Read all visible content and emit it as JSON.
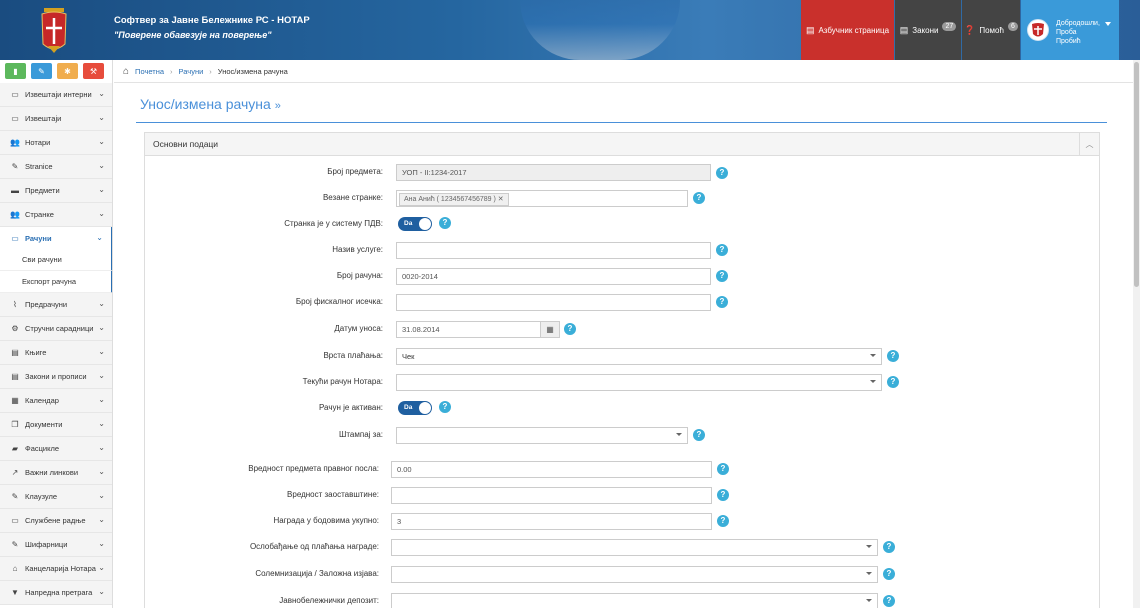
{
  "header": {
    "title": "Софтвер за Јавне Бележнике РС - НОТАР",
    "subtitle": "\"Поверене обавезује на поверење\"",
    "alphabet_label": "Азбучник страница",
    "laws_label": "Закони",
    "laws_count": "27",
    "help_label": "Помоћ",
    "help_count": "6",
    "user_greeting": "Добродошли,",
    "user_first": "Проба",
    "user_last": "Пробић"
  },
  "quick_buttons": [
    {
      "icon": "bar-chart-icon",
      "color": "#5cb85c"
    },
    {
      "icon": "pencil-icon",
      "color": "#3a9ad9"
    },
    {
      "icon": "gear-icon",
      "color": "#f0ad4e"
    },
    {
      "icon": "tools-icon",
      "color": "#e74c3c"
    }
  ],
  "sidebar": {
    "items": [
      {
        "label": "Извештаји интерни",
        "icon": "hdd-icon"
      },
      {
        "label": "Извештаји",
        "icon": "hdd-icon"
      },
      {
        "label": "Нотари",
        "icon": "users-icon"
      },
      {
        "label": "Stranice",
        "icon": "edit-icon"
      },
      {
        "label": "Предмети",
        "icon": "briefcase-icon"
      },
      {
        "label": "Странке",
        "icon": "users-icon"
      },
      {
        "label": "Рачуни",
        "icon": "credit-card-icon",
        "active": true
      },
      {
        "label": "Предрачуни",
        "icon": "paperclip-icon"
      },
      {
        "label": "Стручни сарадници",
        "icon": "wrench-icon"
      },
      {
        "label": "Књиге",
        "icon": "book-icon"
      },
      {
        "label": "Закони и прописи",
        "icon": "book-icon"
      },
      {
        "label": "Календар",
        "icon": "calendar-icon"
      },
      {
        "label": "Документи",
        "icon": "copy-icon"
      },
      {
        "label": "Фасцикле",
        "icon": "folder-icon"
      },
      {
        "label": "Важни линкови",
        "icon": "external-link-icon"
      },
      {
        "label": "Клаузуле",
        "icon": "edit-icon"
      },
      {
        "label": "Службене радње",
        "icon": "hdd-icon"
      },
      {
        "label": "Шифарници",
        "icon": "edit-icon"
      },
      {
        "label": "Канцеларија Нотара",
        "icon": "home-icon"
      },
      {
        "label": "Напредна претрага",
        "icon": "filter-icon"
      }
    ],
    "sub_items": [
      "Сви рачуни",
      "Експорт рачуна"
    ]
  },
  "breadcrumb": {
    "home": "Почетна",
    "section": "Рачуни",
    "current": "Унос/измена рачуна"
  },
  "page": {
    "title": "Унос/измена рачуна",
    "panel_title": "Основни подаци"
  },
  "form": {
    "case_number": {
      "label": "Број предмета:",
      "value": "УОП - II:1234-2017"
    },
    "parties": {
      "label": "Везане странке:",
      "tag": "Ана Анић ( 1234567456789 )"
    },
    "vat": {
      "label": "Странка је у систему ПДВ:",
      "toggle": "Da"
    },
    "service_name": {
      "label": "Назив услуге:",
      "value": ""
    },
    "invoice_number": {
      "label": "Број рачуна:",
      "value": "0020-2014"
    },
    "fiscal_number": {
      "label": "Број фискалног исечка:",
      "value": ""
    },
    "entry_date": {
      "label": "Датум уноса:",
      "value": "31.08.2014"
    },
    "payment_type": {
      "label": "Врста плаћања:",
      "value": "Чек"
    },
    "notary_account": {
      "label": "Текући рачун Нотара:",
      "value": ""
    },
    "active": {
      "label": "Рачун је активан:",
      "toggle": "Da"
    },
    "print_for": {
      "label": "Штампај за:",
      "value": ""
    },
    "legal_value": {
      "label": "Вредност предмета правног посла:",
      "value": "0.00"
    },
    "estate_value": {
      "label": "Вредност заоставштине:",
      "value": ""
    },
    "reward_points": {
      "label": "Награда у бодовима укупно:",
      "value": "3"
    },
    "fee_exemption": {
      "label": "Ослобађање од плаћања награде:",
      "value": ""
    },
    "solemnization": {
      "label": "Солемнизација / Заложна изјава:",
      "value": ""
    },
    "deposit": {
      "label": "Јавнобележнички депозит:",
      "value": ""
    }
  },
  "colors": {
    "header_blue": "#2566a0",
    "alphabet_bg": "#c9302c",
    "dark_btn": "#444444",
    "user_bg": "#3a9ad9",
    "accent": "#2a6fb3",
    "help_icon": "#3aaed8"
  }
}
